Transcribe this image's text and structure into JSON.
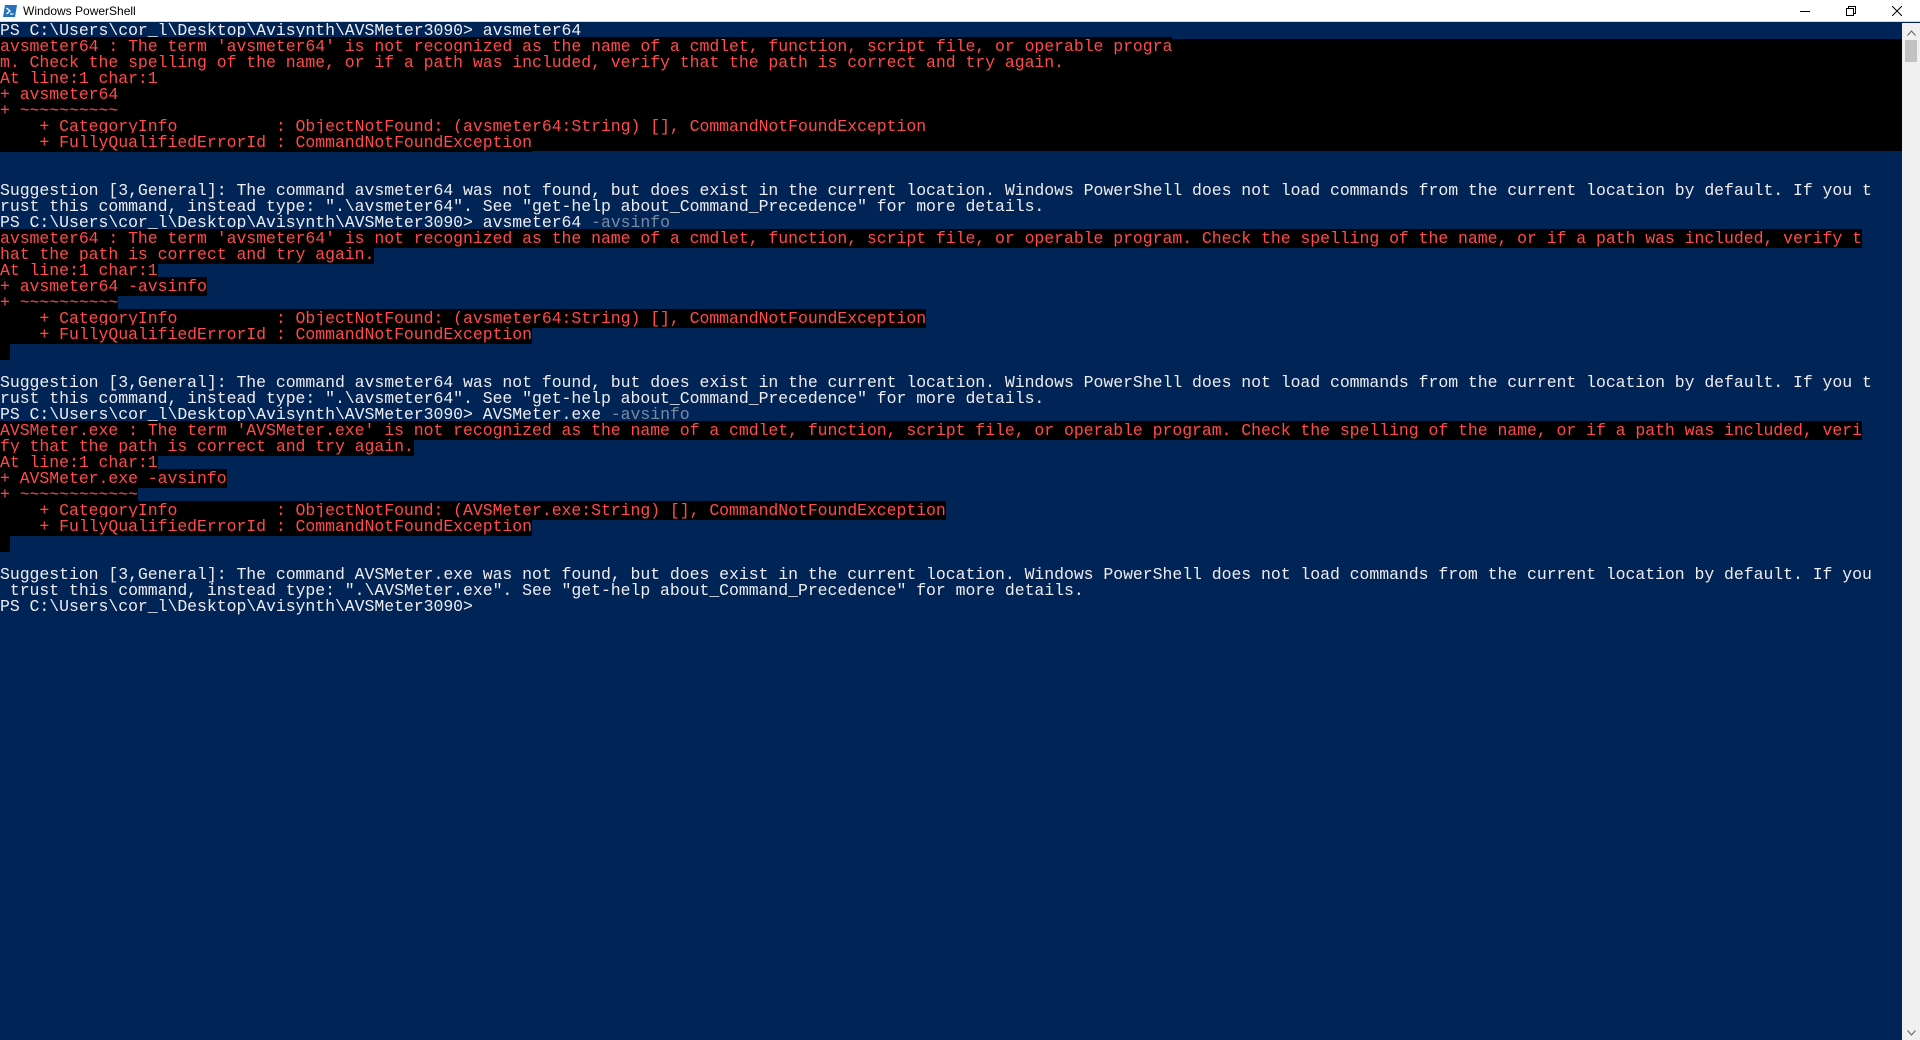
{
  "window": {
    "title": "Windows PowerShell",
    "icon": "powershell-icon",
    "controls": {
      "minimize": "minimize-icon",
      "restore": "restore-icon",
      "close": "close-icon"
    }
  },
  "colors": {
    "background": "#012456",
    "text": "#eeedf0",
    "error_text": "#ff4b4b",
    "error_background": "#000000",
    "argument_text": "#7a8aa0"
  },
  "console": {
    "lines": [
      {
        "kind": "prompt",
        "prompt": "PS C:\\Users\\cor_l\\Desktop\\Avisynth\\AVSMeter3090> ",
        "command": "avsmeter64",
        "args": ""
      },
      {
        "kind": "error",
        "text": "avsmeter64 : The term 'avsmeter64' is not recognized as the name of a cmdlet, function, script file, or operable progra"
      },
      {
        "kind": "error",
        "text": "m. Check the spelling of the name, or if a path was included, verify that the path is correct and try again."
      },
      {
        "kind": "error",
        "text": "At line:1 char:1"
      },
      {
        "kind": "error",
        "text": "+ avsmeter64"
      },
      {
        "kind": "error",
        "text": "+ ~~~~~~~~~~"
      },
      {
        "kind": "error",
        "text": "    + CategoryInfo          : ObjectNotFound: (avsmeter64:String) [], CommandNotFoundException"
      },
      {
        "kind": "error",
        "text": "    + FullyQualifiedErrorId : CommandNotFoundException"
      },
      {
        "kind": "blank",
        "text": ""
      },
      {
        "kind": "blank",
        "text": ""
      },
      {
        "kind": "plain",
        "text": "Suggestion [3,General]: The command avsmeter64 was not found, but does exist in the current location. Windows PowerShell does not load commands from the current location by default. If you t"
      },
      {
        "kind": "plain",
        "text": "rust this command, instead type: \".\\avsmeter64\". See \"get-help about_Command_Precedence\" for more details."
      },
      {
        "kind": "prompt",
        "prompt": "PS C:\\Users\\cor_l\\Desktop\\Avisynth\\AVSMeter3090> ",
        "command": "avsmeter64",
        "args": " -avsinfo"
      },
      {
        "kind": "error",
        "text": "avsmeter64 : The term 'avsmeter64' is not recognized as the name of a cmdlet, function, script file, or operable program. Check the spelling of the name, or if a path was included, verify t"
      },
      {
        "kind": "error",
        "text": "hat the path is correct and try again."
      },
      {
        "kind": "error",
        "text": "At line:1 char:1"
      },
      {
        "kind": "error",
        "text": "+ avsmeter64 -avsinfo"
      },
      {
        "kind": "error",
        "text": "+ ~~~~~~~~~~"
      },
      {
        "kind": "error",
        "text": "    + CategoryInfo          : ObjectNotFound: (avsmeter64:String) [], CommandNotFoundException"
      },
      {
        "kind": "error",
        "text": "    + FullyQualifiedErrorId : CommandNotFoundException"
      },
      {
        "kind": "error",
        "text": " "
      },
      {
        "kind": "blank",
        "text": ""
      },
      {
        "kind": "plain",
        "text": "Suggestion [3,General]: The command avsmeter64 was not found, but does exist in the current location. Windows PowerShell does not load commands from the current location by default. If you t"
      },
      {
        "kind": "plain",
        "text": "rust this command, instead type: \".\\avsmeter64\". See \"get-help about_Command_Precedence\" for more details."
      },
      {
        "kind": "prompt",
        "prompt": "PS C:\\Users\\cor_l\\Desktop\\Avisynth\\AVSMeter3090> ",
        "command": "AVSMeter.exe",
        "args": " -avsinfo"
      },
      {
        "kind": "error",
        "text": "AVSMeter.exe : The term 'AVSMeter.exe' is not recognized as the name of a cmdlet, function, script file, or operable program. Check the spelling of the name, or if a path was included, veri"
      },
      {
        "kind": "error",
        "text": "fy that the path is correct and try again."
      },
      {
        "kind": "error",
        "text": "At line:1 char:1"
      },
      {
        "kind": "error",
        "text": "+ AVSMeter.exe -avsinfo"
      },
      {
        "kind": "error",
        "text": "+ ~~~~~~~~~~~~"
      },
      {
        "kind": "error",
        "text": "    + CategoryInfo          : ObjectNotFound: (AVSMeter.exe:String) [], CommandNotFoundException"
      },
      {
        "kind": "error",
        "text": "    + FullyQualifiedErrorId : CommandNotFoundException"
      },
      {
        "kind": "error",
        "text": " "
      },
      {
        "kind": "blank",
        "text": ""
      },
      {
        "kind": "plain",
        "text": "Suggestion [3,General]: The command AVSMeter.exe was not found, but does exist in the current location. Windows PowerShell does not load commands from the current location by default. If you"
      },
      {
        "kind": "plain",
        "text": " trust this command, instead type: \".\\AVSMeter.exe\". See \"get-help about_Command_Precedence\" for more details."
      },
      {
        "kind": "prompt",
        "prompt": "PS C:\\Users\\cor_l\\Desktop\\Avisynth\\AVSMeter3090> ",
        "command": "",
        "args": ""
      }
    ]
  }
}
